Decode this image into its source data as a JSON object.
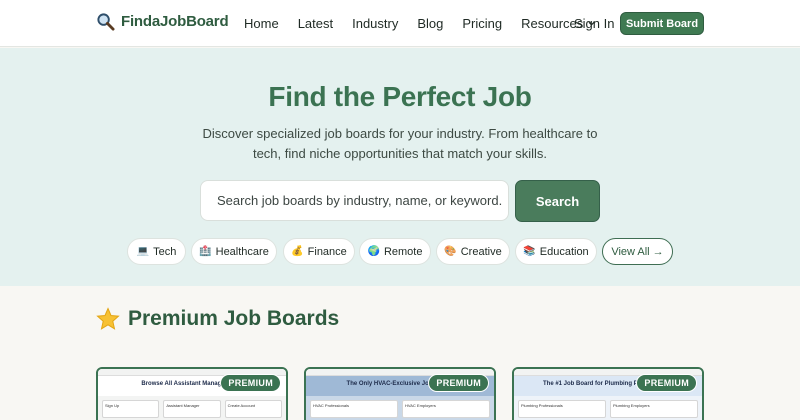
{
  "header": {
    "logo_text": "FindaJobBoard",
    "nav": [
      {
        "label": "Home"
      },
      {
        "label": "Latest"
      },
      {
        "label": "Industry"
      },
      {
        "label": "Blog"
      },
      {
        "label": "Pricing"
      },
      {
        "label": "Resources",
        "icon": "chevron-down-icon"
      }
    ],
    "signin_label": "Sign In",
    "submit_label": "Submit Board"
  },
  "hero": {
    "title": "Find the Perfect Job",
    "subtitle": "Discover specialized job boards for your industry. From healthcare to tech, find niche opportunities that match your skills.",
    "search_placeholder": "Search job boards by industry, name, or keyword.",
    "search_button": "Search",
    "chips": [
      {
        "icon": "💻",
        "label": "Tech"
      },
      {
        "icon": "🏥",
        "label": "Healthcare"
      },
      {
        "icon": "💰",
        "label": "Finance"
      },
      {
        "icon": "🌍",
        "label": "Remote"
      },
      {
        "icon": "🎨",
        "label": "Creative"
      },
      {
        "icon": "📚",
        "label": "Education"
      }
    ],
    "view_all": "View All →"
  },
  "premium": {
    "icon": "star-icon",
    "title": "Premium Job Boards",
    "cards": [
      {
        "badge": "PREMIUM",
        "thumb_title": "Browse All Assistant Manager Jobs",
        "thumb_bg": "#ffffff",
        "thumb_boxes": [
          "Sign Up",
          "Assistant Manager",
          "Create Account"
        ]
      },
      {
        "badge": "PREMIUM",
        "thumb_title": "The Only HVAC-Exclusive Job Market",
        "thumb_bg": "#9fb9d6",
        "thumb_boxes": [
          "HVAC Professionals",
          "HVAC Employers"
        ]
      },
      {
        "badge": "PREMIUM",
        "thumb_title": "The #1 Job Board for Plumbing Professionals",
        "thumb_bg": "#dbe7f5",
        "thumb_boxes": [
          "Plumbing Professionals",
          "Plumbing Employers"
        ]
      }
    ]
  },
  "colors": {
    "brand": "#3b7352",
    "hero_bg": "#e4f1ef",
    "page_bg": "#f8f7f3"
  }
}
